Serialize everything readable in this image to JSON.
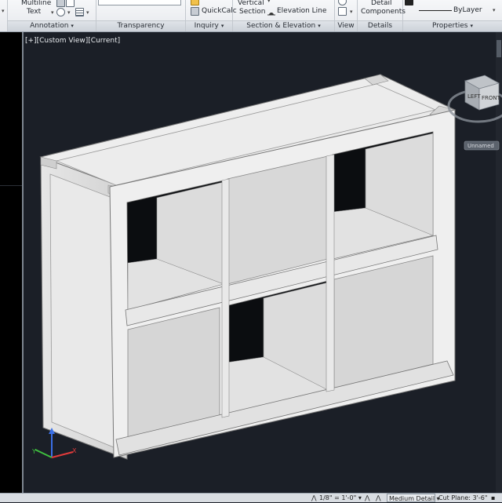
{
  "ribbon": {
    "annotation": {
      "title": "Annotation",
      "multiline_text": [
        "Multiline",
        "Text"
      ]
    },
    "transparency": {
      "title": "Transparency"
    },
    "inquiry": {
      "title": "Inquiry",
      "quickcalc": "QuickCalc"
    },
    "section_elevation": {
      "title": "Section & Elevation",
      "vertical_section": [
        "Vertical",
        "Section"
      ],
      "elevation_line": "Elevation Line"
    },
    "view": {
      "title": "View"
    },
    "details": {
      "title": "Details",
      "detail_components": [
        "Detail",
        "Components"
      ]
    },
    "properties": {
      "title": "Properties",
      "linetype": "ByLayer"
    }
  },
  "viewport": {
    "label": "[+][Custom View][Current]",
    "viewcube": {
      "left_face": "LEFT",
      "front_face": "FRONT",
      "ucs_label": "Unnamed"
    }
  },
  "statusbar": {
    "scale": "1/8\" = 1'-0\"",
    "detail_level": "Medium Detail",
    "cut_plane": "Cut Plane: 3'-6\""
  },
  "colors": {
    "viewport_bg": "#1b1f27",
    "shelf_panel": "#f0f0f0",
    "shelf_shade": "#c8c8c8",
    "axis_x": "#e23b3b",
    "axis_y": "#3fbf3f",
    "axis_z": "#3a6fe6"
  }
}
